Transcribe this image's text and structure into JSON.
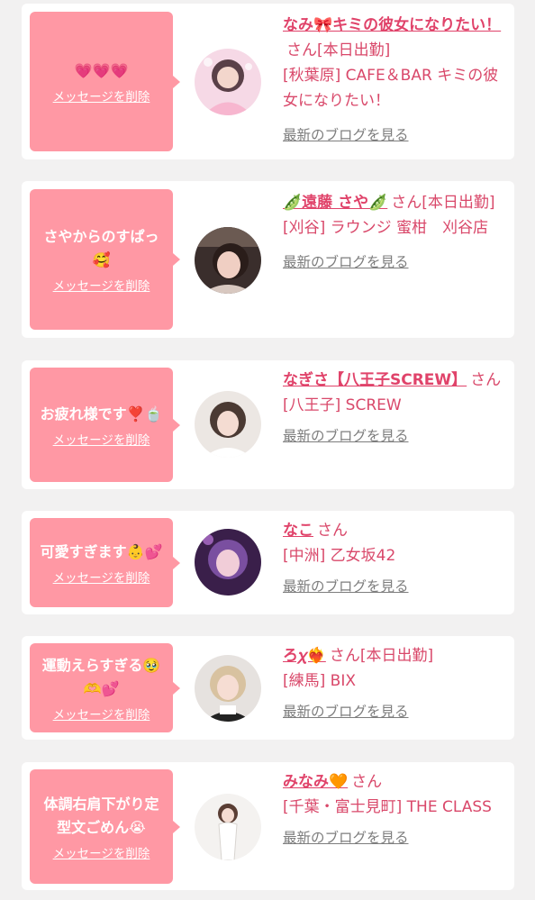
{
  "cards": [
    {
      "message": "💗💗💗",
      "delete_label": "メッセージを削除",
      "name": "なみ🎀キミの彼女になりたい！",
      "honorific": "さん",
      "status": "[本日出勤]",
      "shop": "[秋葉原] CAFE＆BAR キミの彼女になりたい！",
      "blog_label": "最新のブログを見る"
    },
    {
      "message": "さやからのすぱっ🥰",
      "delete_label": "メッセージを削除",
      "name": "🫛遠藤 さや🫛",
      "honorific": "さん",
      "status": "[本日出勤]",
      "shop": "[刈谷] ラウンジ 蜜柑　刈谷店",
      "blog_label": "最新のブログを見る"
    },
    {
      "message": "お疲れ様です❣️🍵",
      "delete_label": "メッセージを削除",
      "name": "なぎさ【八王子SCREW】",
      "honorific": "さん",
      "status": "",
      "shop": "[八王子] SCREW",
      "blog_label": "最新のブログを見る"
    },
    {
      "message": "可愛すぎます👶💕",
      "delete_label": "メッセージを削除",
      "name": "なこ",
      "honorific": "さん",
      "status": "",
      "shop": "[中洲] 乙女坂42",
      "blog_label": "最新のブログを見る"
    },
    {
      "message": "運動えらすぎる🥹🫶💕",
      "delete_label": "メッセージを削除",
      "name": "ろ𝜒❤️‍🔥",
      "honorific": "さん",
      "status": "[本日出勤]",
      "shop": "[練馬] BIX",
      "blog_label": "最新のブログを見る"
    },
    {
      "message": "体調右肩下がり定型文ごめん😭",
      "delete_label": "メッセージを削除",
      "name": "みなみ🧡",
      "honorific": "さん",
      "status": "",
      "shop": "[千葉・富士見町] THE CLASS",
      "blog_label": "最新のブログを見る"
    }
  ],
  "colors": {
    "background": "#f2f1f1",
    "bubble": "#ff98a4",
    "name": "#e0436a",
    "text_pink": "#d9486a",
    "link_gray": "#7d7d7d"
  }
}
